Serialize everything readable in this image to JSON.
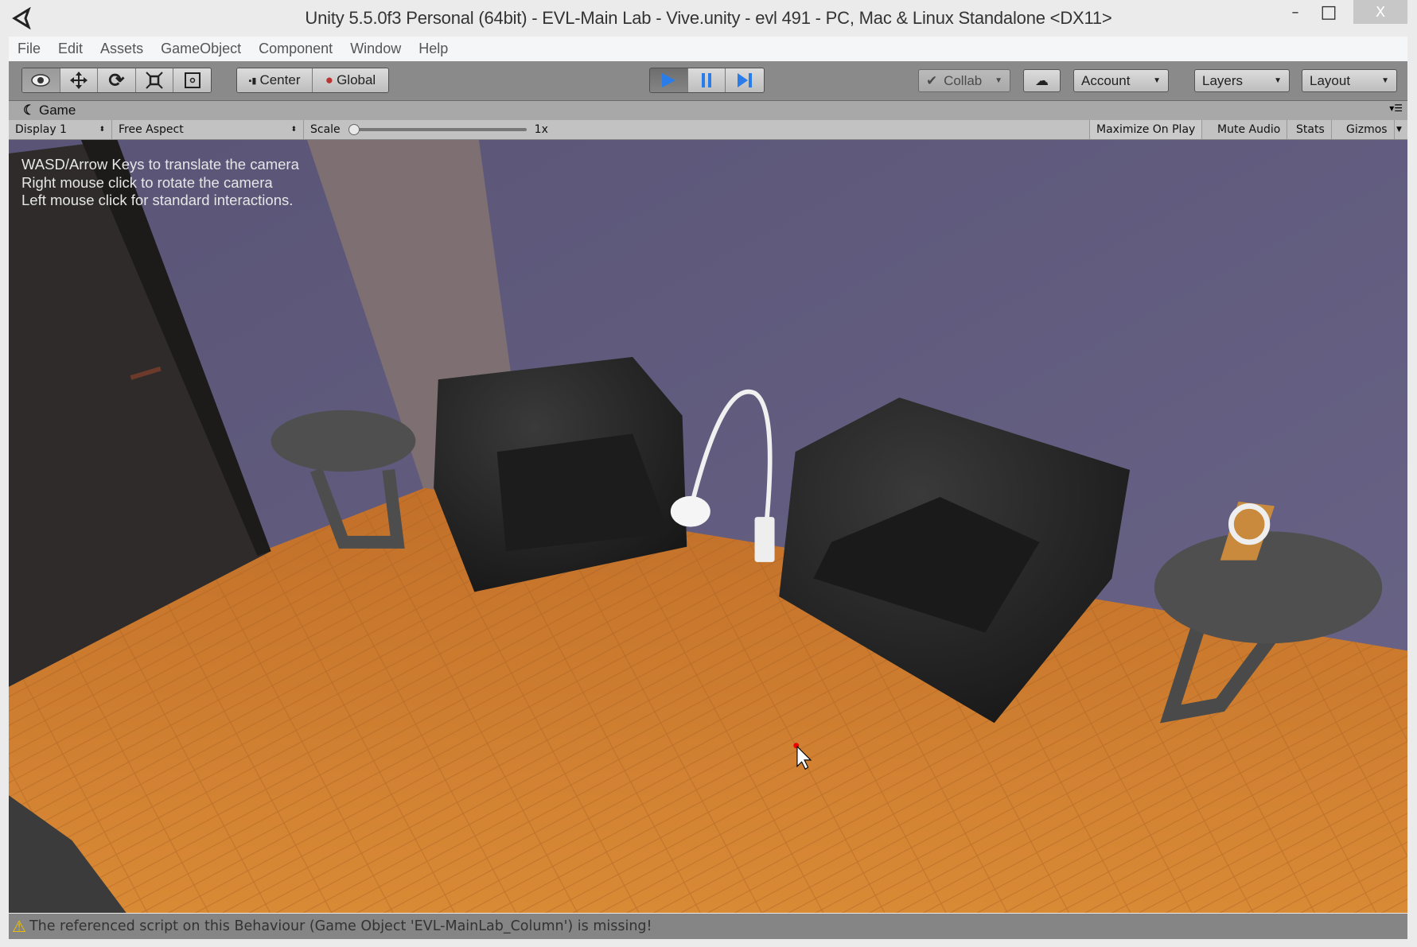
{
  "window": {
    "title": "Unity 5.5.0f3 Personal (64bit) - EVL-Main Lab - Vive.unity - evl 491 - PC, Mac & Linux Standalone <DX11>",
    "minimize": "–",
    "maximize": "□",
    "close": "X"
  },
  "menu": [
    "File",
    "Edit",
    "Assets",
    "GameObject",
    "Component",
    "Window",
    "Help"
  ],
  "toolbar": {
    "tools": [
      "view-tool",
      "move-tool",
      "rotate-tool",
      "scale-tool",
      "rect-tool"
    ],
    "pivot": "Center",
    "space": "Global",
    "collab": "Collab",
    "account": "Account",
    "layers": "Layers",
    "layout": "Layout",
    "play_color": "#2a7de8"
  },
  "game": {
    "tab": "Game",
    "display": "Display 1",
    "aspect": "Free Aspect",
    "scale_label": "Scale",
    "scale_value": "1x",
    "scale_fraction": 0,
    "maximize_on_play": "Maximize On Play",
    "mute_audio": "Mute Audio",
    "stats": "Stats",
    "gizmos": "Gizmos",
    "hints": [
      "WASD/Arrow Keys to translate the camera",
      "Right mouse click to rotate the camera",
      "Left mouse click for standard interactions."
    ]
  },
  "status": {
    "message": "The referenced script on this Behaviour (Game Object 'EVL-MainLab_Column') is missing!"
  }
}
